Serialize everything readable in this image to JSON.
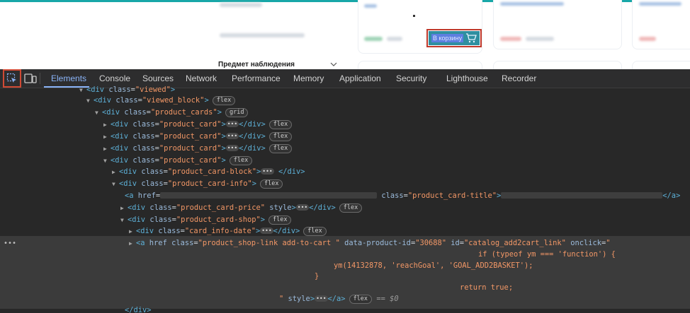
{
  "page": {
    "add_to_cart_label": "В корзину",
    "observe_label": "Предмет наблюдения"
  },
  "devtools": {
    "tabs": [
      "Elements",
      "Console",
      "Sources",
      "Network",
      "Performance",
      "Memory",
      "Application",
      "Security",
      "Lighthouse",
      "Recorder"
    ],
    "active_tab": "Elements"
  },
  "dom": {
    "l0": {
      "tag": "div",
      "attr": "class",
      "val": "\"viewed\""
    },
    "l1": {
      "tag": "div",
      "attr": "class",
      "val": "\"viewed_block\"",
      "badge": "flex"
    },
    "l2": {
      "tag": "div",
      "attr": "class",
      "val": "\"product_cards\"",
      "badge": "grid"
    },
    "l3": {
      "tag": "div",
      "attr": "class",
      "val": "\"product_card\"",
      "close": "</div>",
      "badge": "flex"
    },
    "l4": {
      "tag": "div",
      "attr": "class",
      "val": "\"product_card\"",
      "close": "</div>",
      "badge": "flex"
    },
    "l5": {
      "tag": "div",
      "attr": "class",
      "val": "\"product_card\"",
      "close": "</div>",
      "badge": "flex"
    },
    "l6": {
      "tag": "div",
      "attr": "class",
      "val": "\"product_card\"",
      "badge": "flex"
    },
    "l7": {
      "tag": "div",
      "attr": "class",
      "val": "\"product_card-block\"",
      "close": "</div>"
    },
    "l8": {
      "tag": "div",
      "attr": "class",
      "val": "\"product_card-info\"",
      "badge": "flex"
    },
    "l9": {
      "tag": "a",
      "attr1": "href",
      "attr2": "class",
      "val2": "\"product_card-title\"",
      "close": "</a>"
    },
    "l10": {
      "tag": "div",
      "attr": "class",
      "val": "\"product_card-price\"",
      "attr2": "style",
      "close": "</div>",
      "badge": "flex"
    },
    "l11": {
      "tag": "div",
      "attr": "class",
      "val": "\"product_card-shop\"",
      "badge": "flex"
    },
    "l12": {
      "tag": "div",
      "attr": "class",
      "val": "\"card_info-date\"",
      "close": "</div>",
      "badge": "flex"
    },
    "l13": {
      "tag": "a",
      "attr1": "href",
      "attr2": "class",
      "val2": "\"product_shop-link add-to-cart \"",
      "attr3": "data-product-id",
      "val3": "\"30688\"",
      "attr4": "id",
      "val4": "\"catalog_add2cart_link\"",
      "attr5": "onclick",
      "val5": "\""
    },
    "l14": "if (typeof ym === 'function') {",
    "l15": "ym(14132878, 'reachGoal', 'GOAL_ADD2BASKET');",
    "l16": "}",
    "l17": "return true;",
    "l18": {
      "val": "\"",
      "attr": "style",
      "close": "</a>",
      "badge": "flex",
      "marker": "== $0"
    },
    "l19": {
      "close": "</div>"
    }
  },
  "colors": {
    "accent": "#8ab4f8",
    "highlight_border": "#d04a35",
    "teal": "#18a7a8"
  }
}
